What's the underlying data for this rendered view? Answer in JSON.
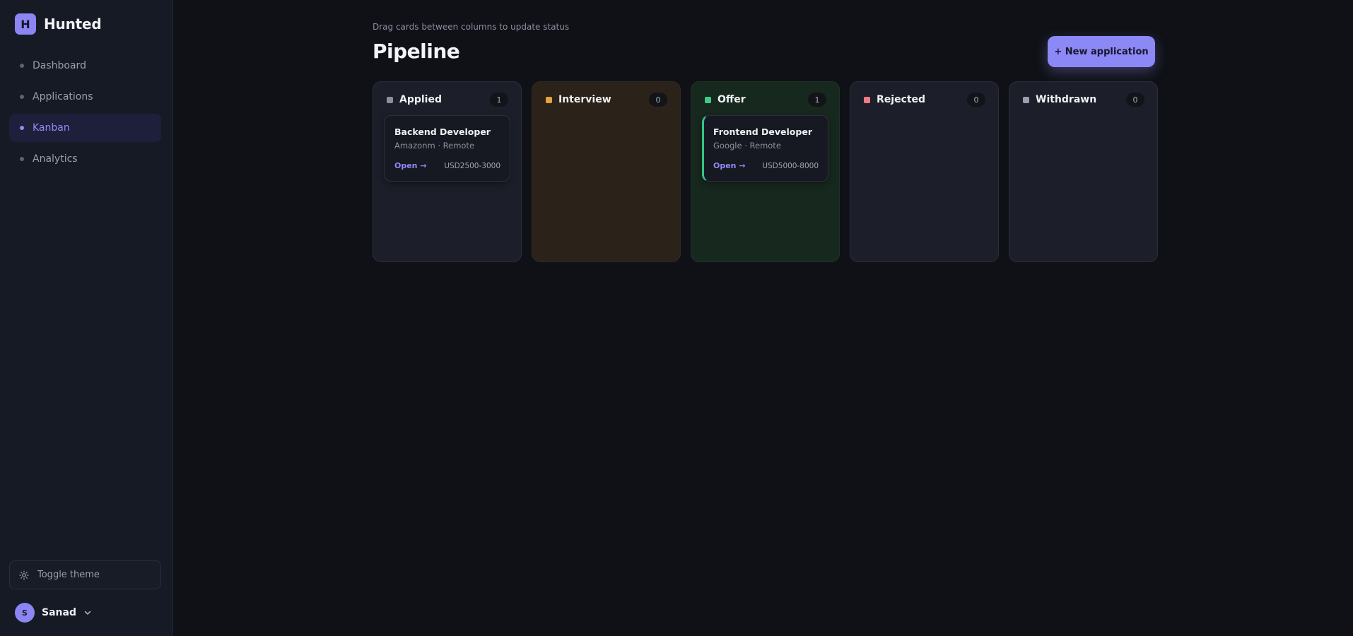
{
  "brand": {
    "initial": "H",
    "name": "Hunted"
  },
  "nav": [
    {
      "label": "Dashboard",
      "active": false
    },
    {
      "label": "Applications",
      "active": false
    },
    {
      "label": "Kanban",
      "active": true
    },
    {
      "label": "Analytics",
      "active": false
    }
  ],
  "toggle_theme": {
    "label": "Toggle theme"
  },
  "user": {
    "initial": "S",
    "name": "Sanad"
  },
  "header": {
    "subtitle": "Drag cards between columns to update status",
    "title": "Pipeline",
    "new_button": "+ New application"
  },
  "columns": [
    {
      "title": "Applied",
      "count": "1",
      "color": "#8b8f9c",
      "cards": [
        {
          "title": "Backend Developer",
          "meta": "Amazonm · Remote",
          "link": "Open →",
          "salary": "USD2500-3000"
        }
      ]
    },
    {
      "title": "Interview",
      "count": "0",
      "color": "#e8a33d",
      "cards": []
    },
    {
      "title": "Offer",
      "count": "1",
      "color": "#3ccb8a",
      "cards": [
        {
          "title": "Frontend Developer",
          "meta": "Google · Remote",
          "link": "Open →",
          "salary": "USD5000-8000"
        }
      ]
    },
    {
      "title": "Rejected",
      "count": "0",
      "color": "#f07b86",
      "cards": []
    },
    {
      "title": "Withdrawn",
      "count": "0",
      "color": "#9a9ead",
      "cards": []
    }
  ]
}
